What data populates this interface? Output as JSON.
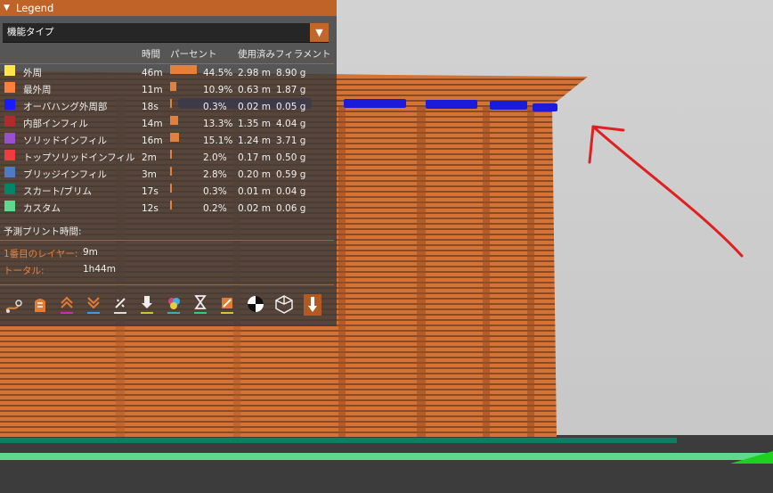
{
  "legend": {
    "title": "Legend",
    "view_type": "機能タイプ",
    "columns": {
      "time": "時間",
      "percent": "パーセント",
      "filament": "使用済みフィラメント"
    },
    "rows": [
      {
        "name": "外周",
        "color": "#ffe44d",
        "time": "46m",
        "percent": "44.5%",
        "pct_value": 44.5,
        "length": "2.98 m",
        "weight": "8.90 g"
      },
      {
        "name": "最外周",
        "color": "#ff7f3a",
        "time": "11m",
        "percent": "10.9%",
        "pct_value": 10.9,
        "length": "0.63 m",
        "weight": "1.87 g"
      },
      {
        "name": "オーバハング外周部",
        "color": "#1a1aff",
        "time": "18s",
        "percent": "0.3%",
        "pct_value": 0.3,
        "length": "0.02 m",
        "weight": "0.05 g"
      },
      {
        "name": "内部インフィル",
        "color": "#b12b2b",
        "time": "14m",
        "percent": "13.3%",
        "pct_value": 13.3,
        "length": "1.35 m",
        "weight": "4.04 g"
      },
      {
        "name": "ソリッドインフィル",
        "color": "#9a4fd0",
        "time": "16m",
        "percent": "15.1%",
        "pct_value": 15.1,
        "length": "1.24 m",
        "weight": "3.71 g"
      },
      {
        "name": "トップソリッドインフィル",
        "color": "#f03c3c",
        "time": "2m",
        "percent": "2.0%",
        "pct_value": 2.0,
        "length": "0.17 m",
        "weight": "0.50 g"
      },
      {
        "name": "ブリッジインフィル",
        "color": "#4e7ac7",
        "time": "3m",
        "percent": "2.8%",
        "pct_value": 2.8,
        "length": "0.20 m",
        "weight": "0.59 g"
      },
      {
        "name": "スカート/ブリム",
        "color": "#00876a",
        "time": "17s",
        "percent": "0.3%",
        "pct_value": 0.3,
        "length": "0.01 m",
        "weight": "0.04 g"
      },
      {
        "name": "カスタム",
        "color": "#5ed98e",
        "time": "12s",
        "percent": "0.2%",
        "pct_value": 0.2,
        "length": "0.02 m",
        "weight": "0.06 g"
      }
    ],
    "estimate": {
      "title": "予測プリント時間:",
      "first_layer_label": "1番目のレイヤー:",
      "first_layer_value": "9m",
      "total_label": "トータル:",
      "total_value": "1h44m"
    },
    "toolbar_icons": [
      "travel-icon",
      "wipe-icon",
      "retractions-icon",
      "deretractions-icon",
      "seams-icon",
      "tool-changes-icon",
      "color-changes-icon",
      "pause-prints-icon",
      "custom-gcodes-icon",
      "center-of-gravity-icon",
      "shells-icon",
      "tool-marker-icon"
    ]
  }
}
